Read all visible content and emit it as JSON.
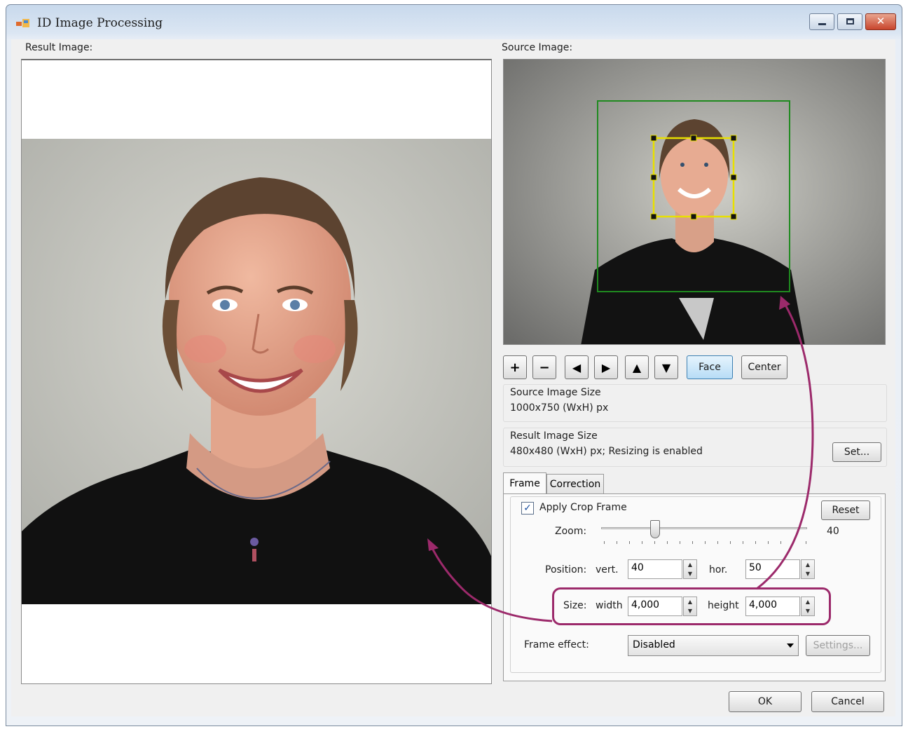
{
  "window": {
    "title": "ID Image Processing"
  },
  "result_image": {
    "label": "Result Image:"
  },
  "source_image": {
    "label": "Source Image:"
  },
  "toolbar": {
    "zoom_in": "+",
    "zoom_out": "−",
    "move_left": "◀",
    "move_right": "▶",
    "move_up": "▲",
    "move_down": "▼",
    "face": "Face",
    "center": "Center"
  },
  "source_size": {
    "heading": "Source Image Size",
    "value": "1000x750 (WxH) px"
  },
  "result_size": {
    "heading": "Result Image Size",
    "value": "480x480 (WxH) px; Resizing is enabled",
    "set_button": "Set..."
  },
  "tabs": [
    {
      "label": "Frame",
      "active": true
    },
    {
      "label": "Correction",
      "active": false
    }
  ],
  "frame": {
    "apply_crop_label": "Apply Crop Frame",
    "apply_crop_checked": true,
    "reset_button": "Reset",
    "zoom_label": "Zoom:",
    "zoom_value": "40",
    "position_label": "Position:",
    "vert_label": "vert.",
    "vert_value": "40",
    "hor_label": "hor.",
    "hor_value": "50",
    "size_label": "Size:",
    "width_label": "width",
    "width_value": "4,000",
    "height_label": "height",
    "height_value": "4,000",
    "frame_effect_label": "Frame effect:",
    "frame_effect_value": "Disabled",
    "settings_button": "Settings..."
  },
  "dialog": {
    "ok": "OK",
    "cancel": "Cancel"
  },
  "colors": {
    "highlight": "#9c2a6b",
    "face_frame": "#e8e000",
    "crop_frame": "#1f8a1f"
  }
}
